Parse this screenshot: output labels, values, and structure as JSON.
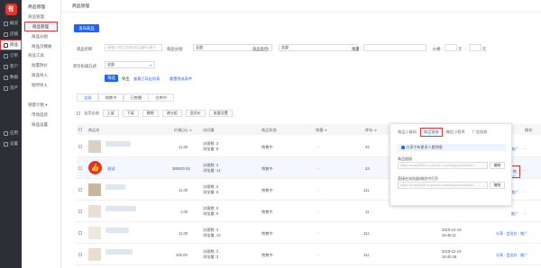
{
  "rail": {
    "items": [
      {
        "label": "概况",
        "icon": "overview-icon"
      },
      {
        "label": "店铺",
        "icon": "store-icon"
      },
      {
        "label": "商品",
        "icon": "goods-icon",
        "active": true
      },
      {
        "label": "订单",
        "icon": "order-icon"
      },
      {
        "label": "客户",
        "icon": "customer-icon"
      },
      {
        "label": "数据",
        "icon": "data-icon"
      },
      {
        "label": "资产",
        "icon": "asset-icon"
      }
    ],
    "bottom": [
      {
        "label": "应用",
        "icon": "apps-icon"
      },
      {
        "label": "设置",
        "icon": "settings-icon"
      }
    ]
  },
  "sub": {
    "title": "商品管理",
    "group1": "商品管理",
    "items1": [
      "商品管理",
      "商品分组",
      "商品页模板"
    ],
    "group2": "商品工具",
    "items2": [
      "批量改价",
      "商品导入",
      "批时导入"
    ],
    "group3": "销量计数 ▾",
    "items3": [
      "市场选货",
      "商品设置"
    ]
  },
  "header": {
    "title": "商品管理"
  },
  "toolbar": {
    "publish": "发布商品"
  },
  "filters": {
    "name_label": "商品名称:",
    "name_placeholder": "请输入商品名称/商品编码/编号",
    "group_label": "商品分组:",
    "group_value": "全部",
    "type_label": "商品类型:",
    "type_value": "全部",
    "sales_label": "销量:",
    "price_label": "价格:",
    "price_unit1": "元",
    "price_unit2": "元",
    "stock_label": "库存扣减方式:",
    "stock_value": "全部",
    "filter_btn": "筛选",
    "export_btn": "导出",
    "view_export": "查看已导出列表",
    "reset": "重置筛选条件"
  },
  "tabs": [
    "全部",
    "销售中",
    "已售罄",
    "仓库中"
  ],
  "actions": {
    "select_all": "当页全选",
    "buttons": [
      "上架",
      "下架",
      "删除",
      "改分组",
      "会员价",
      "批量设置"
    ]
  },
  "table": {
    "headers": [
      "商品名",
      "价格(元) ≑",
      "访问量",
      "商品状态",
      "销量 ≑",
      "库存 ≑",
      "序号",
      "创建时间",
      "操作"
    ],
    "rows": [
      {
        "price": "11.00",
        "visits": "访客数: 3",
        "views": "浏览量: 8",
        "status": "销售中",
        "sales": "-",
        "stock": "32",
        "icon": "product-thumbnail-icon"
      },
      {
        "name": "测试",
        "price": "380000.00",
        "visits": "访客数: 4",
        "views": "浏览量: 14",
        "status": "销售中",
        "sales": "-",
        "stock": "33",
        "icon": "thumbs-up-icon"
      },
      {
        "price": "11.00",
        "visits": "访客数: 2",
        "views": "浏览量: 6",
        "status": "销售中",
        "sales": "-",
        "stock": "111",
        "icon": "product-thumbnail-icon"
      },
      {
        "price": "1.00",
        "visits": "访客数: 0",
        "views": "浏览量: 0",
        "status": "销售中",
        "sales": "-",
        "stock": "11",
        "icon": "product-thumbnail-icon"
      },
      {
        "price": "11.00",
        "visits": "访客数: 3",
        "views": "浏览量: 13",
        "status": "销售中",
        "sales": "-",
        "stock": "111",
        "date": "2019-12-19",
        "time": "16:46:11",
        "op": "分享 · 会员价 · 推广"
      },
      {
        "price": "100.00",
        "visits": "访客数: 2",
        "views": "浏览量: 3",
        "status": "销售中",
        "sales": "-",
        "stock": "111",
        "date": "2019-12-19",
        "time": "16:40:28",
        "op": "分享 · 会员价 · 推广"
      }
    ],
    "op_links": [
      "推广",
      "···"
    ]
  },
  "popover": {
    "tabs": [
      "商品二维码",
      "商品链接",
      "微信小程序",
      "广告投放"
    ],
    "notice": "分享才有更多人看到哦",
    "link_label": "商品链接",
    "link_value": "https://shop28000.m.youzan.com/wscgoods/detail/...",
    "copy1": "复制",
    "wx_label": "直接在浏览器/微信中打开",
    "wx_value": "https://shop28000.m.youzan.com/wscgoods/detail/...",
    "copy2": "复制"
  },
  "colors": {
    "accent": "#1d64ff",
    "highlight": "#e6332a",
    "rail_bg": "#2d2f36"
  }
}
